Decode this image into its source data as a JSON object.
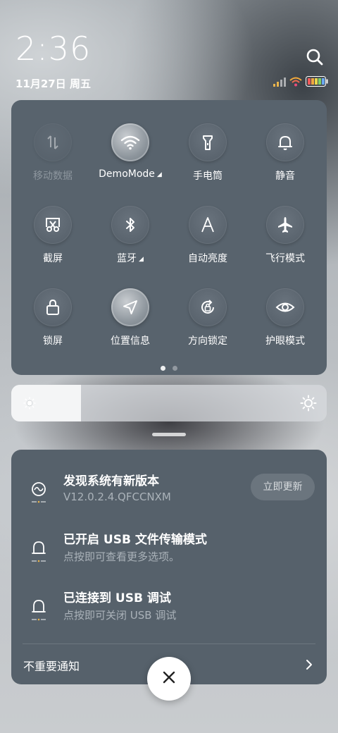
{
  "status_bar": {
    "time": "2:36",
    "date": "11月27日 周五",
    "icons": [
      "signal-icon",
      "wifi-icon",
      "battery-icon"
    ]
  },
  "quick_settings": {
    "tiles": [
      {
        "label": "移动数据",
        "icon": "mobile-data-icon",
        "state": "disabled"
      },
      {
        "label": "DemoMode",
        "icon": "wifi-icon",
        "state": "on",
        "expandable": true
      },
      {
        "label": "手电筒",
        "icon": "flashlight-icon",
        "state": "off"
      },
      {
        "label": "静音",
        "icon": "bell-icon",
        "state": "off"
      },
      {
        "label": "截屏",
        "icon": "screenshot-icon",
        "state": "off"
      },
      {
        "label": "蓝牙",
        "icon": "bluetooth-icon",
        "state": "off",
        "expandable": true
      },
      {
        "label": "自动亮度",
        "icon": "auto-brightness-icon",
        "state": "off"
      },
      {
        "label": "飞行模式",
        "icon": "airplane-icon",
        "state": "off"
      },
      {
        "label": "锁屏",
        "icon": "lock-icon",
        "state": "off"
      },
      {
        "label": "位置信息",
        "icon": "location-icon",
        "state": "on"
      },
      {
        "label": "方向锁定",
        "icon": "rotation-lock-icon",
        "state": "off"
      },
      {
        "label": "护眼模式",
        "icon": "eye-icon",
        "state": "off"
      }
    ],
    "pages": 2,
    "current_page": 1
  },
  "brightness": {
    "level": 0.22
  },
  "notifications": [
    {
      "title": "发现系统有新版本",
      "subtitle": "V12.0.2.4.QFCCNXM",
      "icon": "update-icon",
      "action": "立即更新"
    },
    {
      "title": "已开启 USB 文件传输模式",
      "subtitle": "点按即可查看更多选项。",
      "icon": "bell-icon"
    },
    {
      "title": "已连接到 USB 调试",
      "subtitle": "点按即可关闭 USB 调试",
      "icon": "bell-icon"
    }
  ],
  "unimportant_label": "不重要通知",
  "colors": {
    "panel": "#58636d",
    "notif_panel": "#56616b",
    "active_tile": "#c9cdd1"
  }
}
